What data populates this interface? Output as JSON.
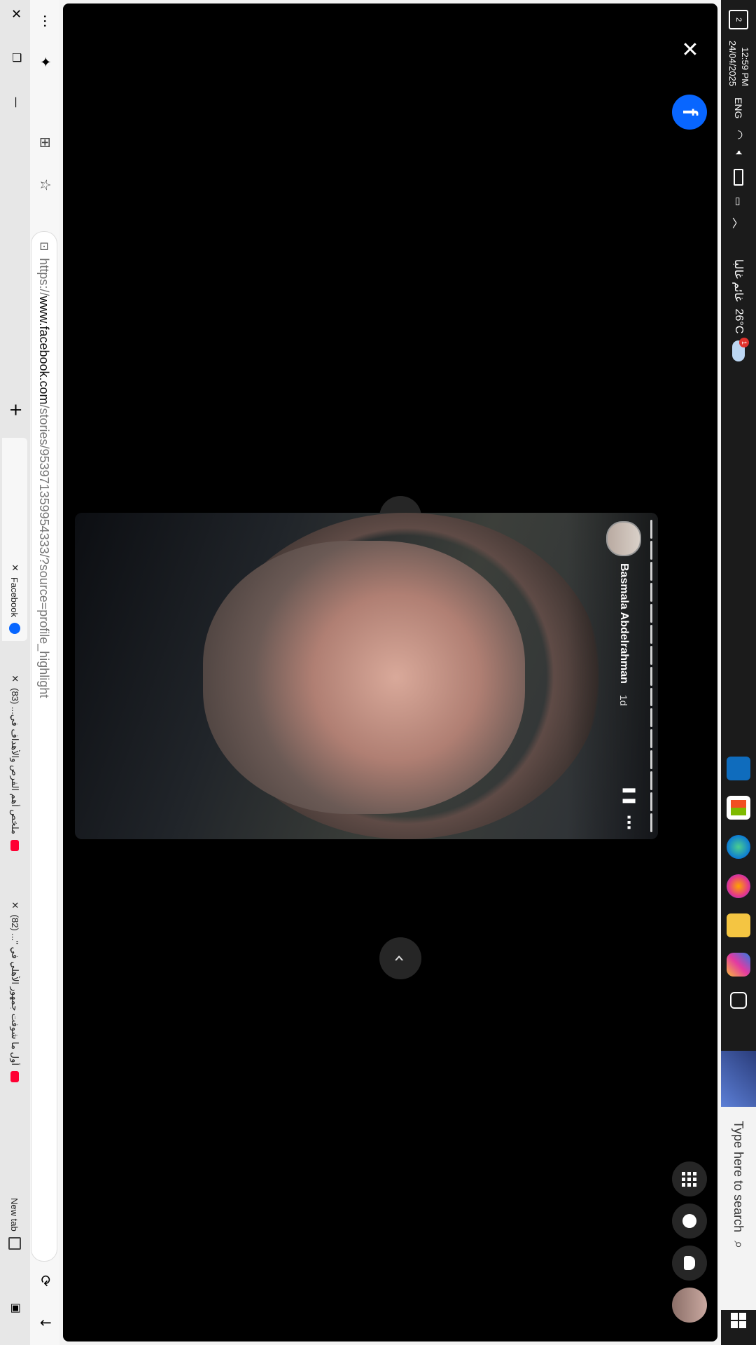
{
  "taskbar": {
    "time": "12:59 PM",
    "date": "24/04/2025",
    "language": "ENG",
    "weather_temp": "26°C",
    "weather_text": "غائم غالبا",
    "notification_count": "2",
    "search_placeholder": "Type here to search",
    "weather_badge": "1"
  },
  "browser": {
    "tabs": [
      {
        "label": "New tab"
      },
      {
        "label": "أول ما شوفت جمهور الأهلي في \"... (82)"
      },
      {
        "label": "ملخص أهم الفرص والأهداف في... (83)"
      },
      {
        "label": "Facebook"
      }
    ],
    "url_prefix": "https://",
    "url_host": "www.facebook.com",
    "url_path": "/stories/953971359954333/?source=profile_highlight"
  },
  "story": {
    "author": "Basmala Abdelrahman",
    "time_ago": "1d"
  },
  "colors": {
    "facebook_blue": "#0866ff",
    "page_bg": "#000000",
    "taskbar_bg": "#1b1b1b"
  }
}
